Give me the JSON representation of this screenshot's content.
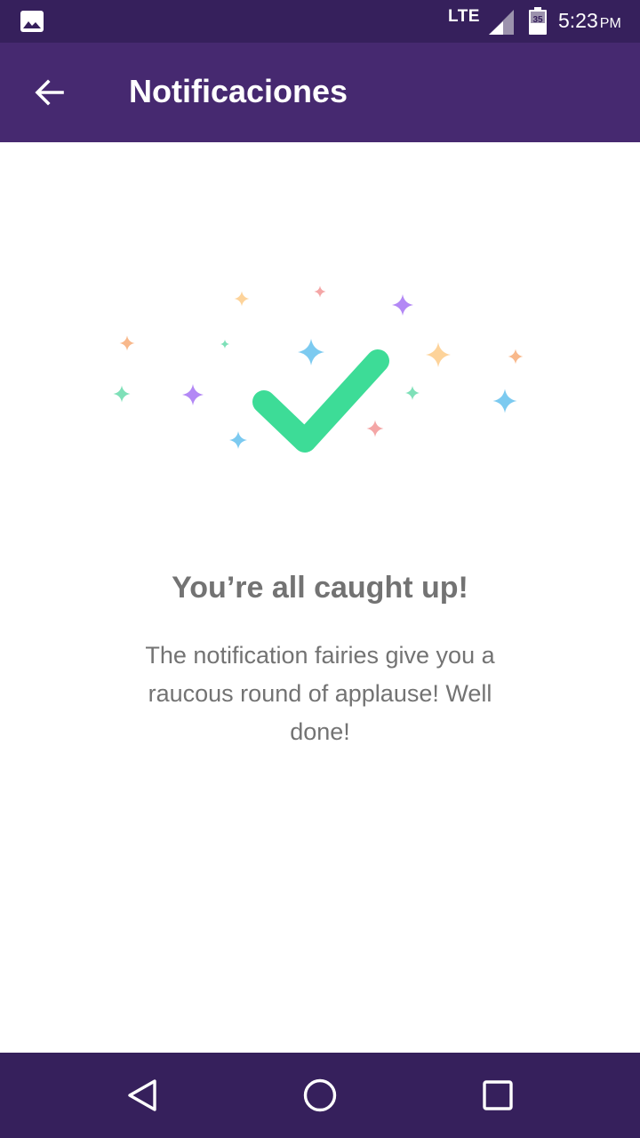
{
  "status_bar": {
    "network": "LTE",
    "battery_level": "35",
    "time": "5:23",
    "ampm": "PM",
    "icons": [
      "gallery-icon",
      "signal-icon",
      "battery-icon"
    ]
  },
  "app_bar": {
    "title": "Notificaciones",
    "back_icon": "arrow-left-icon",
    "background": "#462970"
  },
  "empty_state": {
    "headline": "You’re all caught up!",
    "message": "The notification fairies give you a raucous round of applause! Well done!",
    "check_color": "#3ddc97",
    "sparkle_colors": [
      "#fdd39a",
      "#f4a6a6",
      "#b388f5",
      "#7ccaf0",
      "#7ee0b8",
      "#f8b88b"
    ]
  },
  "nav_bar": {
    "buttons": [
      "back-triangle-icon",
      "home-circle-icon",
      "recents-square-icon"
    ]
  }
}
